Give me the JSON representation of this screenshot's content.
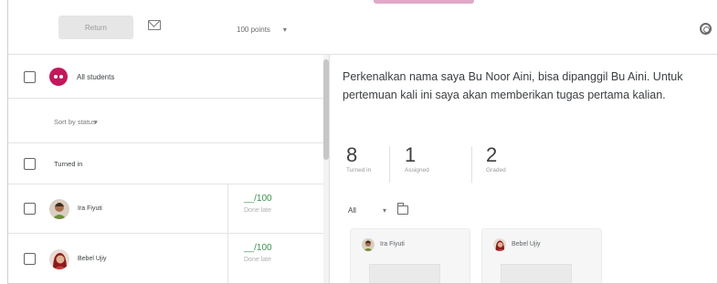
{
  "toolbar": {
    "return_label": "Return",
    "points_value": "100 points",
    "points_caret": "▾",
    "mail_icon": "mail-icon",
    "settings_icon": "gear-icon"
  },
  "students_panel": {
    "all_students_label": "All students",
    "sort_label": "Sort by status",
    "sort_caret": "▾",
    "turned_in_label": "Turned in",
    "students": [
      {
        "name": "Ira Fiyuti",
        "grade": "__/100",
        "status": "Done late"
      },
      {
        "name": "Bebel Ujiy",
        "grade": "__/100",
        "status": "Done late"
      }
    ]
  },
  "assignment": {
    "instructions": "Perkenalkan nama saya Bu Noor Aini, bisa dipanggil Bu Aini. Untuk pertemuan kali ini saya akan memberikan tugas pertama kalian.",
    "stats": [
      {
        "value": "8",
        "label": "Turned in"
      },
      {
        "value": "1",
        "label": "Assigned"
      },
      {
        "value": "2",
        "label": "Graded"
      }
    ],
    "filter_value": "All",
    "filter_caret": "▾",
    "cards": [
      {
        "name": "Ira Fiyuti"
      },
      {
        "name": "Bebel Ujiy"
      }
    ]
  },
  "colors": {
    "class_avatar": "#c2185b",
    "grade_green": "#3f8f4e",
    "accent_pink": "#e1a8c8"
  }
}
